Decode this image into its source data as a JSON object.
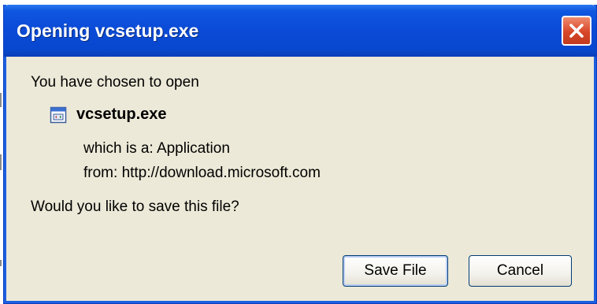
{
  "dialog": {
    "title": "Opening vcsetup.exe",
    "close_icon": "close-icon",
    "intro": "You have chosen to open",
    "file": {
      "icon": "application-file-icon",
      "name": "vcsetup.exe",
      "type_label": "which is a:",
      "type_value": "Application",
      "from_label": "from:",
      "from_value": "http://download.microsoft.com"
    },
    "question": "Would you like to save this file?",
    "buttons": {
      "save": "Save File",
      "cancel": "Cancel"
    }
  },
  "colors": {
    "titlebar": "#0a4ad6",
    "dialog_bg": "#ece9d8",
    "close_button": "#d8472a"
  }
}
